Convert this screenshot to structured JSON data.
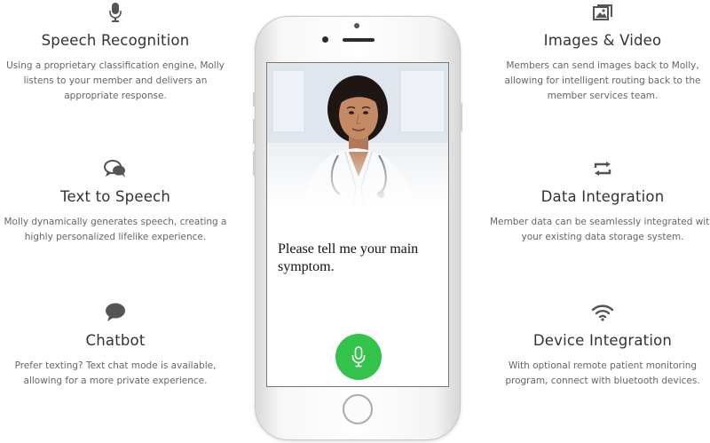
{
  "features": {
    "speech": {
      "icon": "microphone-icon",
      "title": "Speech Recognition",
      "description": "Using a proprietary classification engine, Molly listens to your member and delivers an appropriate response."
    },
    "tts": {
      "icon": "speech-bubbles-icon",
      "title": "Text to Speech",
      "description": "Molly dynamically generates speech, creating a highly personalized lifelike experience."
    },
    "chat": {
      "icon": "chat-bubble-icon",
      "title": "Chatbot",
      "description": "Prefer texting? Text chat mode is available, allowing for a more private experience."
    },
    "images": {
      "icon": "images-icon",
      "title": "Images & Video",
      "description": "Members can send images back to Molly, allowing for intelligent routing back to the member services team."
    },
    "data": {
      "icon": "sync-arrows-icon",
      "title": "Data Integration",
      "description": "Member data can be seamlessly integrated with your existing data storage system."
    },
    "device": {
      "icon": "wifi-icon",
      "title": "Device Integration",
      "description": "With optional remote patient monitoring program, connect with bluetooth devices."
    }
  },
  "phone": {
    "prompt": "Please tell me your main symptom.",
    "mic_button_color": "#33c24a"
  },
  "colors": {
    "icon": "#555555",
    "accent": "#33c24a"
  }
}
